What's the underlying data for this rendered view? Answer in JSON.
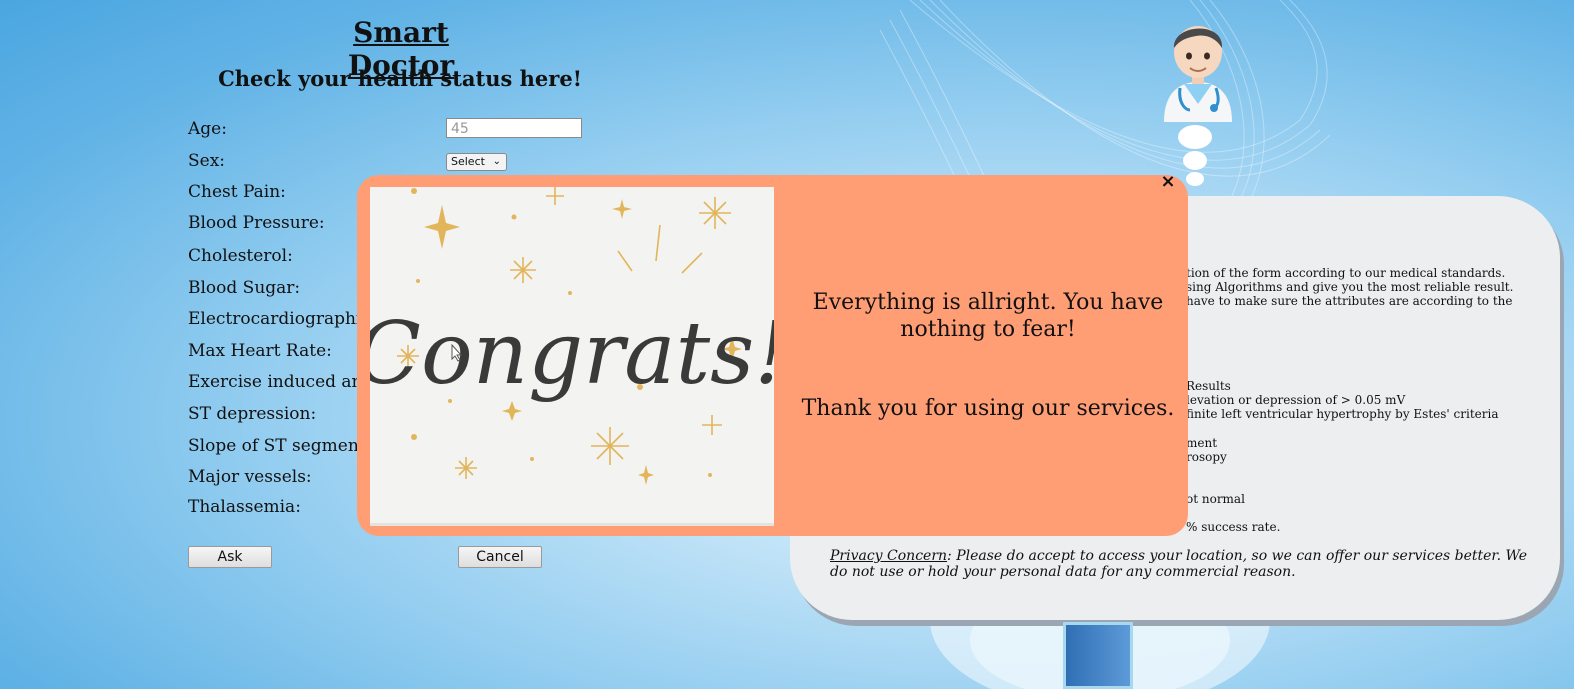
{
  "header": {
    "title": "Smart Doctor",
    "subtitle": "Check your health status here!"
  },
  "form": {
    "labels": [
      "Age:",
      "Sex:",
      "Chest Pain:",
      "Blood Pressure:",
      "Cholesterol:",
      "Blood Sugar:",
      "Electrocardiographi",
      "Max Heart Rate:",
      "Exercise induced an",
      "ST depression:",
      "Slope of ST segmen",
      "Major vessels:",
      "Thalassemia:"
    ],
    "age_placeholder": "45",
    "sex_selected": "Select",
    "ask_label": "Ask",
    "cancel_label": "Cancel"
  },
  "info": {
    "lines": [
      "tion of the form according to our medical standards.",
      "sing Algorithms and give you the most reliable result.",
      "have to make sure the attributes are according to the",
      "Results",
      "levation or depression of > 0.05 mV",
      "finite left ventricular hypertrophy by Estes' criteria",
      "ment",
      "rosopy",
      "ot normal",
      "% success rate."
    ],
    "privacy_label": "Privacy Concern",
    "privacy_text": ": Please do accept to access your location, so we can offer our services better. We do not use or hold your personal data for any commercial reason."
  },
  "modal": {
    "close_symbol": "×",
    "image_text": "Congrats!",
    "message": "Everything is allright. You have nothing to fear!",
    "thanks": "Thank you for using our services."
  },
  "colors": {
    "modal_bg": "#ff9e75",
    "card_bg": "#eceef0",
    "sparkle": "#e3b55b"
  },
  "icons": {
    "doctor": "doctor-emoji-icon",
    "close": "close-icon",
    "dropdown": "chevron-down-icon"
  }
}
